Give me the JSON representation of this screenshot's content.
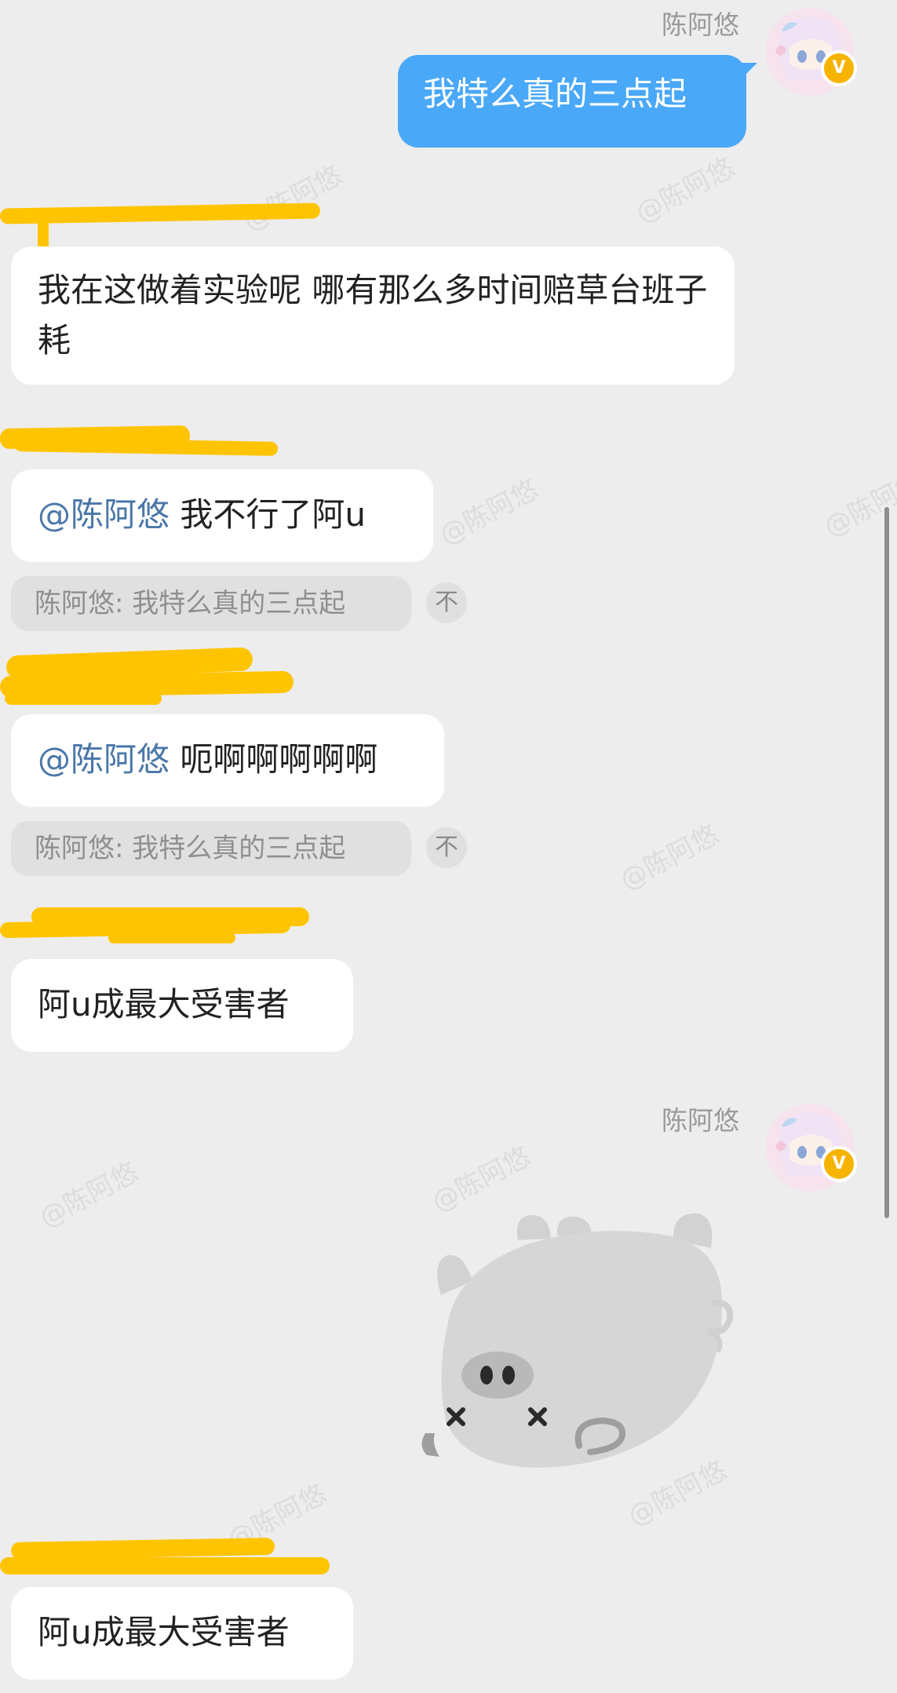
{
  "chat": {
    "self_name": "陈阿悠",
    "self_message": "我特么真的三点起",
    "messages": [
      {
        "text": "我在这做着实验呢  哪有那么多时间赔草台班子耗"
      },
      {
        "mention": "@陈阿悠",
        "text": "我不行了阿u",
        "quote": "陈阿悠: 我特么真的三点起",
        "quote_icon": "不"
      },
      {
        "mention": "@陈阿悠",
        "text": "呃啊啊啊啊啊",
        "quote": "陈阿悠: 我特么真的三点起",
        "quote_icon": "不"
      },
      {
        "text": "阿u成最大受害者"
      },
      {
        "text": "阿u成最大受害者"
      }
    ],
    "self_name_2": "陈阿悠",
    "verified_badge": "V",
    "sticker": "dead-pig-sticker"
  },
  "watermark": "@陈阿悠",
  "colors": {
    "background": "#ededed",
    "self_bubble": "#4aa8f8",
    "other_bubble": "#ffffff",
    "mention": "#4a77a8",
    "redaction": "#ffc400",
    "badge": "#f6b400"
  }
}
